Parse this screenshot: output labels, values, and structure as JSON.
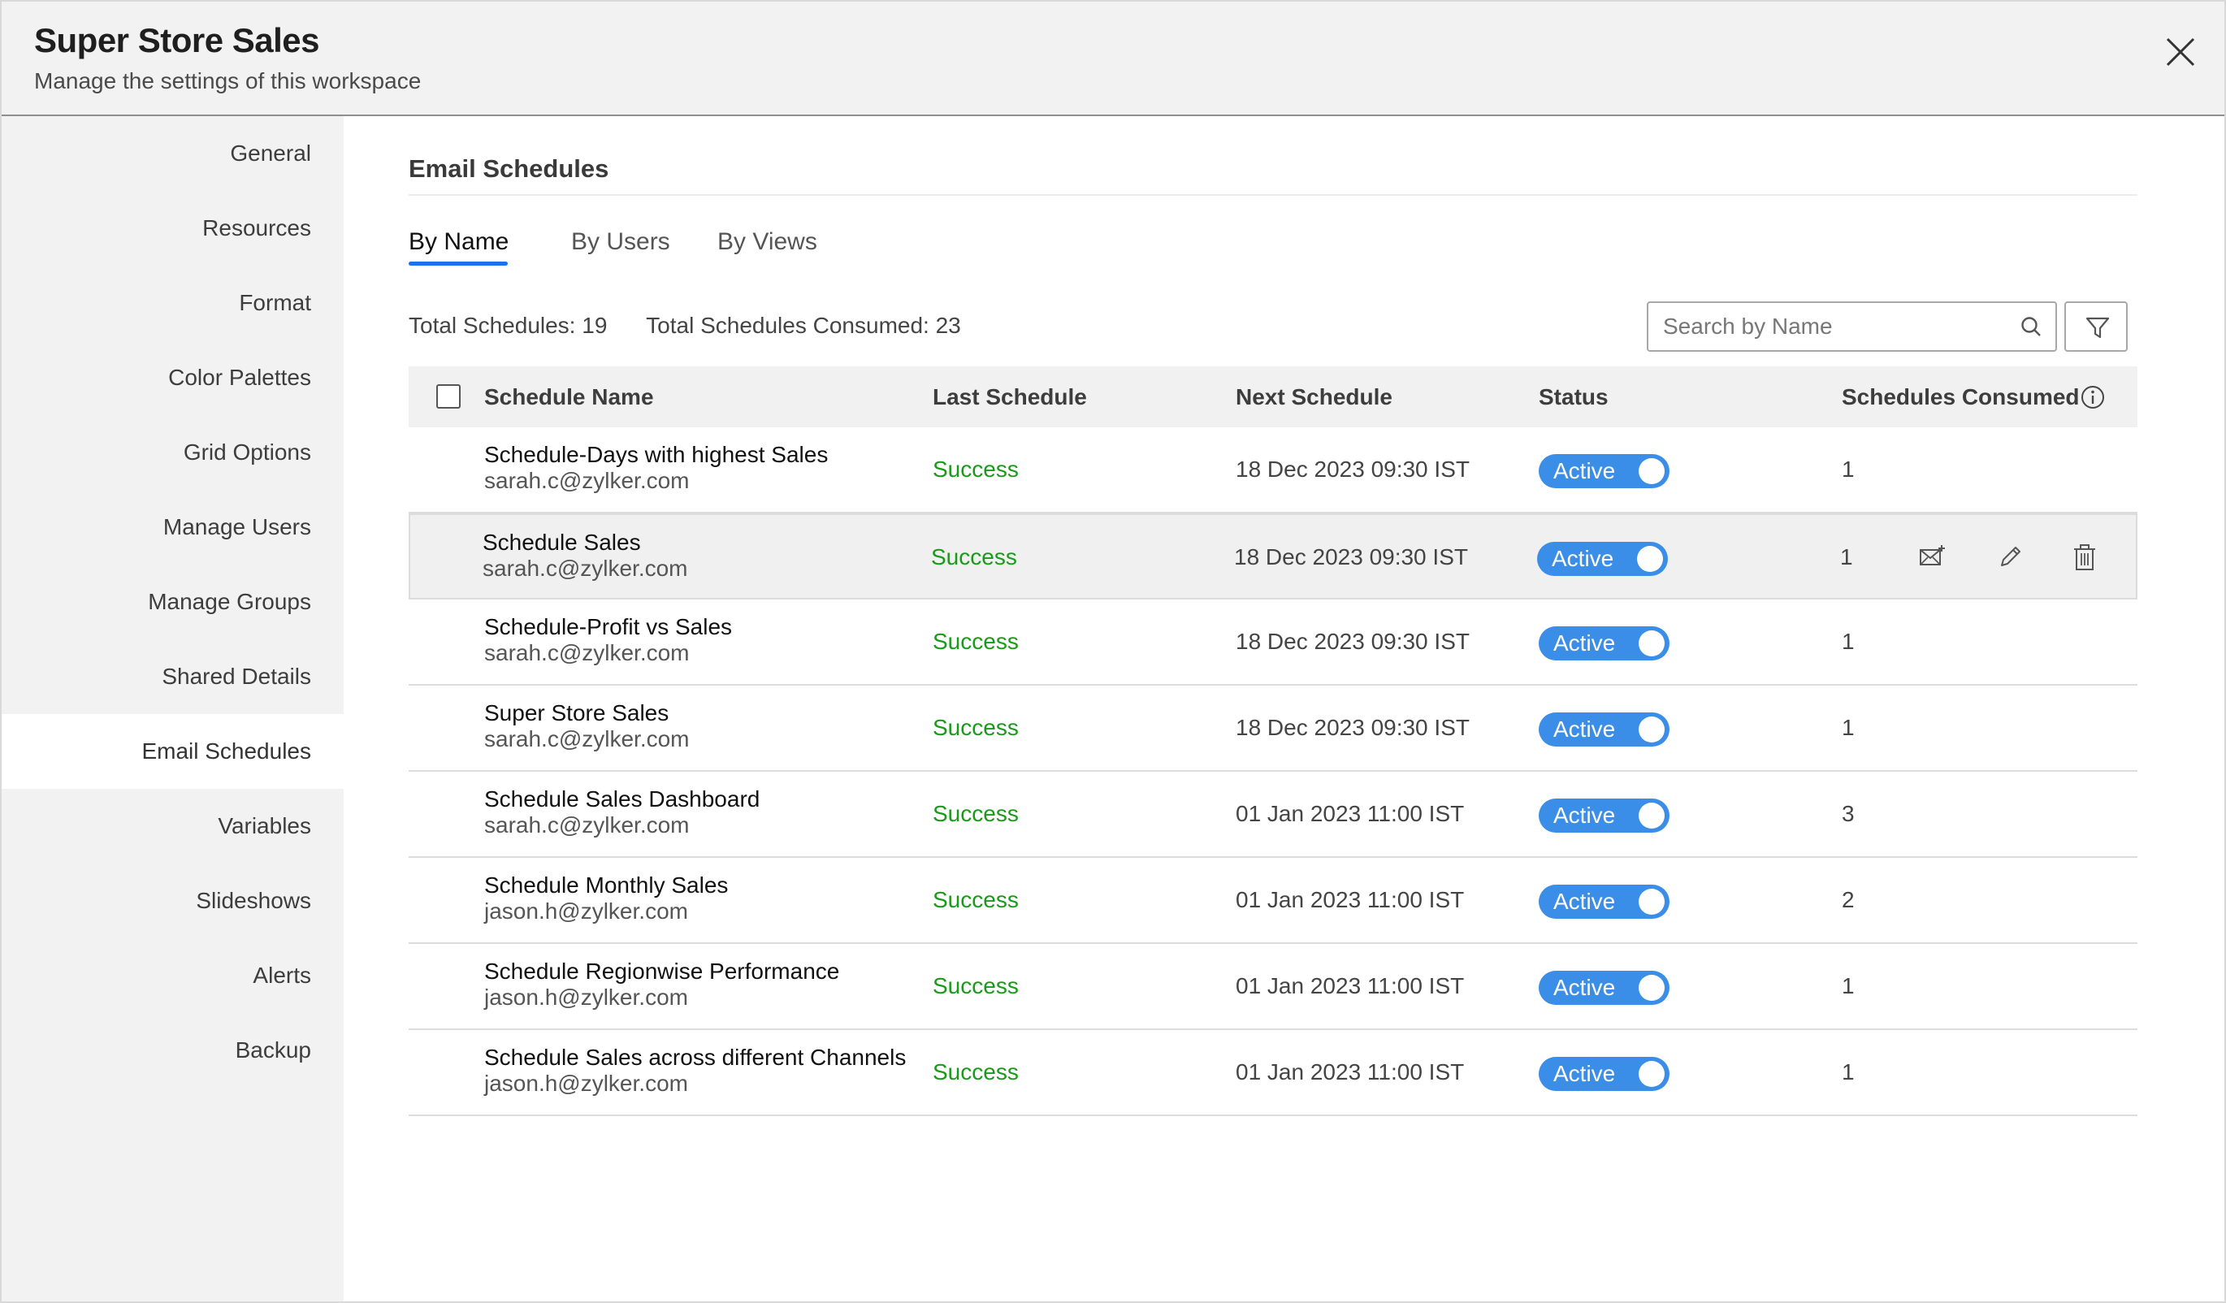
{
  "header": {
    "title": "Super Store Sales",
    "subtitle": "Manage the settings of this workspace"
  },
  "sidebar": {
    "items": [
      {
        "label": "General"
      },
      {
        "label": "Resources"
      },
      {
        "label": "Format"
      },
      {
        "label": "Color Palettes"
      },
      {
        "label": "Grid Options"
      },
      {
        "label": "Manage Users"
      },
      {
        "label": "Manage Groups"
      },
      {
        "label": "Shared Details"
      },
      {
        "label": "Email Schedules",
        "active": true
      },
      {
        "label": "Variables"
      },
      {
        "label": "Slideshows"
      },
      {
        "label": "Alerts"
      },
      {
        "label": "Backup"
      }
    ]
  },
  "main": {
    "title": "Email Schedules",
    "tabs": [
      {
        "label": "By Name",
        "active": true
      },
      {
        "label": "By Users"
      },
      {
        "label": "By Views"
      }
    ],
    "total_schedules": "Total Schedules: 19",
    "total_consumed": "Total Schedules Consumed: 23",
    "search": {
      "placeholder": "Search by Name"
    }
  },
  "table": {
    "columns": [
      "Schedule Name",
      "Last Schedule",
      "Next Schedule",
      "Status",
      "Schedules Consumed"
    ],
    "rows": [
      {
        "name": "Schedule-Days with highest Sales",
        "email": "sarah.c@zylker.com",
        "last": "Success",
        "next": "18 Dec 2023 09:30 IST",
        "status": "Active",
        "consumed": "1"
      },
      {
        "name": "Schedule Sales",
        "email": "sarah.c@zylker.com",
        "last": "Success",
        "next": "18 Dec 2023 09:30 IST",
        "status": "Active",
        "consumed": "1",
        "hover": true
      },
      {
        "name": "Schedule-Profit vs Sales",
        "email": "sarah.c@zylker.com",
        "last": "Success",
        "next": "18 Dec 2023 09:30 IST",
        "status": "Active",
        "consumed": "1"
      },
      {
        "name": "Super Store Sales",
        "email": "sarah.c@zylker.com",
        "last": "Success",
        "next": "18 Dec 2023 09:30 IST",
        "status": "Active",
        "consumed": "1"
      },
      {
        "name": "Schedule Sales Dashboard",
        "email": "sarah.c@zylker.com",
        "last": "Success",
        "next": "01 Jan 2023 11:00 IST",
        "status": "Active",
        "consumed": "3"
      },
      {
        "name": "Schedule Monthly Sales",
        "email": "jason.h@zylker.com",
        "last": "Success",
        "next": "01 Jan 2023 11:00 IST",
        "status": "Active",
        "consumed": "2"
      },
      {
        "name": "Schedule Regionwise Performance",
        "email": "jason.h@zylker.com",
        "last": "Success",
        "next": "01 Jan 2023 11:00 IST",
        "status": "Active",
        "consumed": "1"
      },
      {
        "name": "Schedule Sales across different Channels",
        "email": "jason.h@zylker.com",
        "last": "Success",
        "next": "01 Jan 2023 11:00 IST",
        "status": "Active",
        "consumed": "1"
      }
    ]
  },
  "icons": {
    "close": "close-icon",
    "search": "search-icon",
    "filter": "filter-icon",
    "info": "info-icon",
    "send_now": "mail-send-icon",
    "edit": "pencil-icon",
    "delete": "trash-icon"
  },
  "colors": {
    "accent": "#1a73e8",
    "toggle": "#3b8ee8",
    "success": "#1a9a1a"
  }
}
